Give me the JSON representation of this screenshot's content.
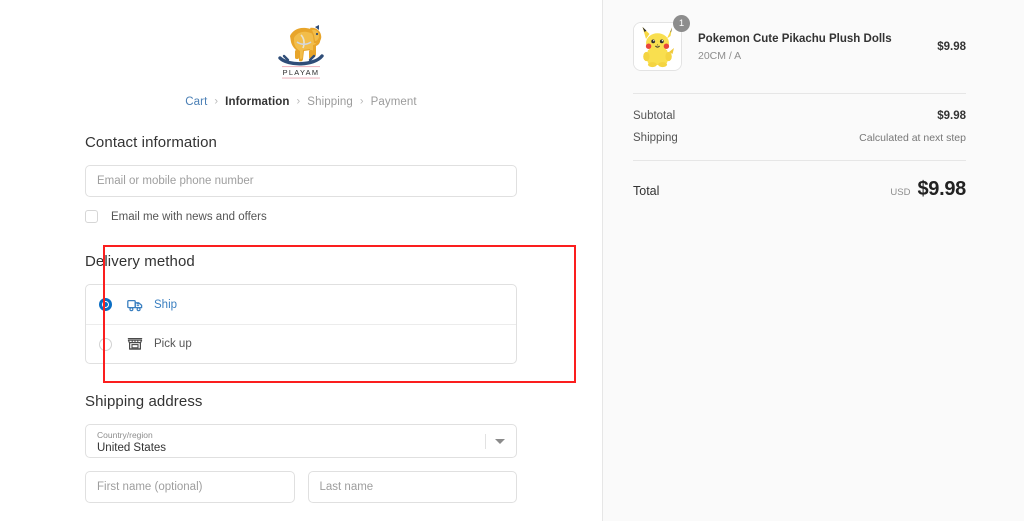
{
  "brand": {
    "logo_icon": "rocking-horse-icon",
    "wordmark": "PLAYAM"
  },
  "breadcrumb": {
    "separator": "›",
    "items": [
      {
        "label": "Cart",
        "state": "link"
      },
      {
        "label": "Information",
        "state": "current"
      },
      {
        "label": "Shipping",
        "state": "muted"
      },
      {
        "label": "Payment",
        "state": "muted"
      }
    ]
  },
  "contact": {
    "title": "Contact information",
    "email_placeholder": "Email or mobile phone number",
    "email_value": "",
    "newsletter_label": "Email me with news and offers",
    "newsletter_checked": false
  },
  "delivery": {
    "title": "Delivery method",
    "options": [
      {
        "label": "Ship",
        "icon": "delivery-truck-icon",
        "selected": true
      },
      {
        "label": "Pick up",
        "icon": "storefront-icon",
        "selected": false
      }
    ]
  },
  "shipping_address": {
    "title": "Shipping address",
    "country": {
      "label": "Country/region",
      "value": "United States",
      "caret_icon": "chevron-down-icon"
    },
    "first_name_placeholder": "First name (optional)",
    "first_name_value": "",
    "last_name_placeholder": "Last name",
    "last_name_value": ""
  },
  "summary": {
    "item": {
      "title": "Pokemon Cute Pikachu Plush Dolls",
      "variant": "20CM / A",
      "price": "$9.98",
      "quantity_badge": "1",
      "thumbnail_icon": "pikachu-plush-image"
    },
    "subtotal_label": "Subtotal",
    "subtotal_value": "$9.98",
    "shipping_label": "Shipping",
    "shipping_value": "Calculated at next step",
    "total_label": "Total",
    "total_currency": "USD",
    "total_value": "$9.98"
  },
  "annotation": {
    "highlight_color": "#fb1e1e",
    "target": "delivery-method-section"
  },
  "colors": {
    "accent_blue": "#0b6ec4",
    "link_blue": "#4a7fb5",
    "panel_bg": "#fafafa",
    "text": "#333333",
    "muted_text": "#8d8d8d",
    "border": "#e0e0e0"
  }
}
